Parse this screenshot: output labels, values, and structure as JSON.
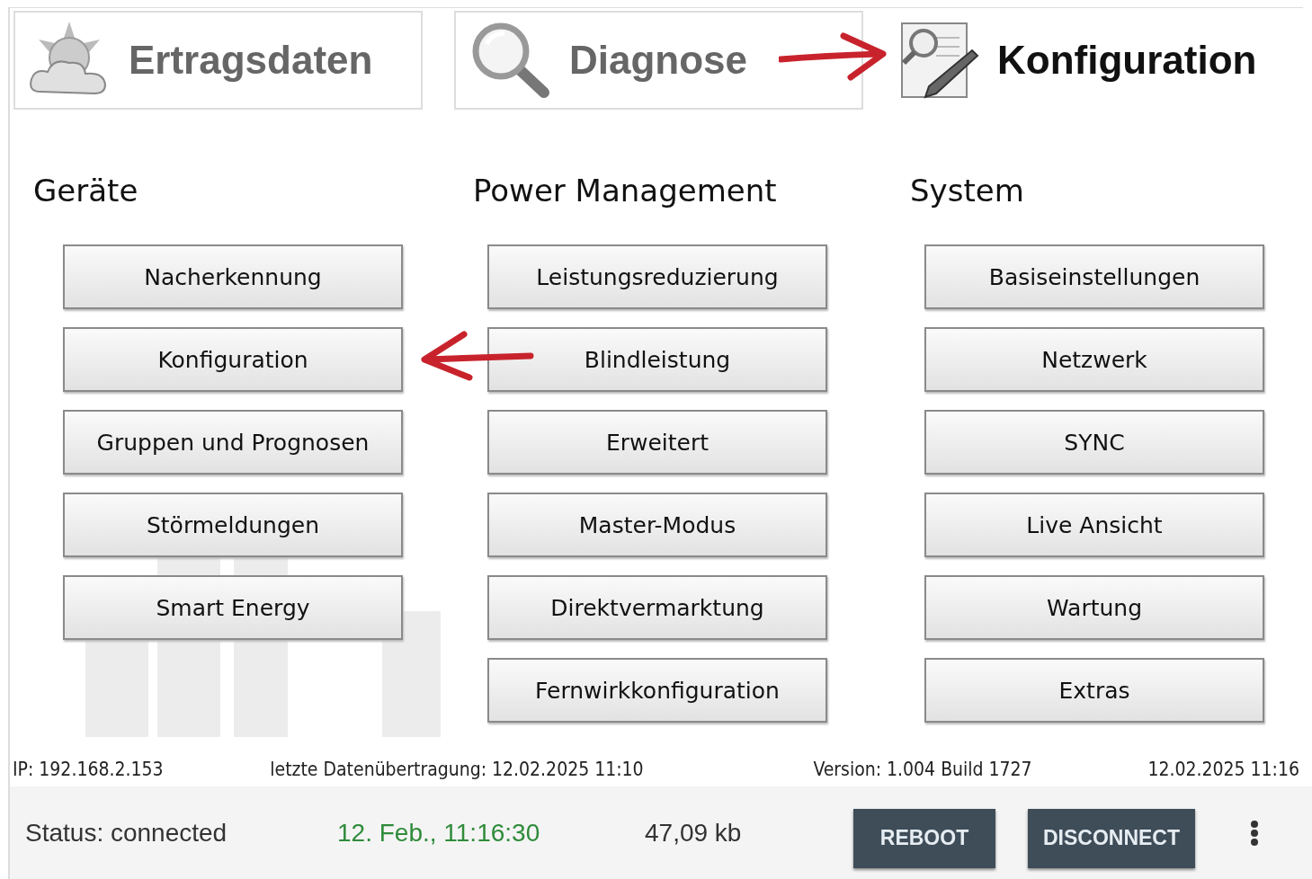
{
  "tabs": [
    {
      "label": "Ertragsdaten",
      "kind": "weather",
      "selected": false
    },
    {
      "label": "Diagnose",
      "kind": "search",
      "selected": false
    },
    {
      "label": "Konfiguration",
      "kind": "edit",
      "selected": true
    }
  ],
  "columns": [
    {
      "heading": "Geräte",
      "buttons": [
        "Nacherkennung",
        "Konfiguration",
        "Gruppen und Prognosen",
        "Störmeldungen",
        "Smart Energy"
      ]
    },
    {
      "heading": "Power Management",
      "buttons": [
        "Leistungsreduzierung",
        "Blindleistung",
        "Erweitert",
        "Master-Modus",
        "Direktvermarktung",
        "Fernwirkkonfiguration"
      ]
    },
    {
      "heading": "System",
      "buttons": [
        "Basiseinstellungen",
        "Netzwerk",
        "SYNC",
        "Live Ansicht",
        "Wartung",
        "Extras"
      ]
    }
  ],
  "info_line": {
    "ip": "IP: 192.168.2.153",
    "last_transfer": "letzte Datenübertragung: 12.02.2025 11:10",
    "version": "Version: 1.004 Build 1727",
    "datetime": "12.02.2025 11:16"
  },
  "status_bar": {
    "status": "Status: connected",
    "time": "12. Feb., 11:16:30",
    "size": "47,09 kb",
    "buttons": [
      "REBOOT",
      "DISCONNECT"
    ]
  }
}
